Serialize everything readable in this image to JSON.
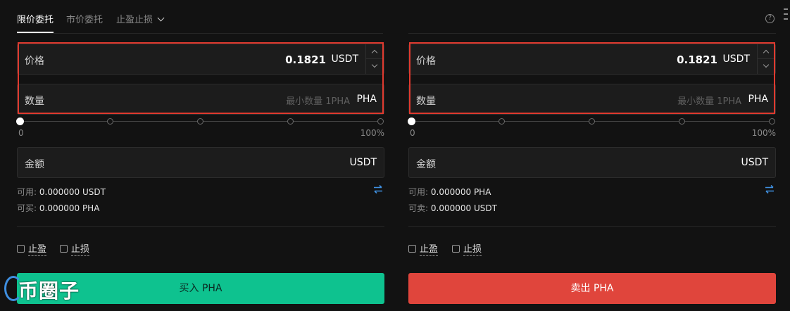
{
  "tabs": [
    {
      "label": "限价委托",
      "active": true
    },
    {
      "label": "市价委托",
      "active": false
    },
    {
      "label": "止盈止损",
      "active": false
    }
  ],
  "help_icon": "question-circle-icon",
  "buy": {
    "price_label": "价格",
    "price_value": "0.1821",
    "price_unit": "USDT",
    "amount_label": "数量",
    "amount_placeholder": "最小数量 1PHA",
    "amount_unit": "PHA",
    "slider_min": "0",
    "slider_max": "100%",
    "slider_value": 0,
    "total_label": "金额",
    "total_unit": "USDT",
    "available_label": "可用:",
    "available_value": "0.000000 USDT",
    "max_label": "可买:",
    "max_value": "0.000000 PHA",
    "take_profit": "止盈",
    "stop_loss": "止损",
    "action_label": "买入 PHA",
    "action_color": "#0ec28f"
  },
  "sell": {
    "price_label": "价格",
    "price_value": "0.1821",
    "price_unit": "USDT",
    "amount_label": "数量",
    "amount_placeholder": "最小数量 1PHA",
    "amount_unit": "PHA",
    "slider_min": "0",
    "slider_max": "100%",
    "slider_value": 0,
    "total_label": "金额",
    "total_unit": "USDT",
    "available_label": "可用:",
    "available_value": "0.000000 PHA",
    "max_label": "可卖:",
    "max_value": "0.000000 USDT",
    "take_profit": "止盈",
    "stop_loss": "止损",
    "action_label": "卖出 PHA",
    "action_color": "#e0453c"
  },
  "watermark": {
    "text": "币圈子"
  },
  "colors": {
    "highlight": "#e03a2f",
    "accent": "#3f8fe0"
  }
}
